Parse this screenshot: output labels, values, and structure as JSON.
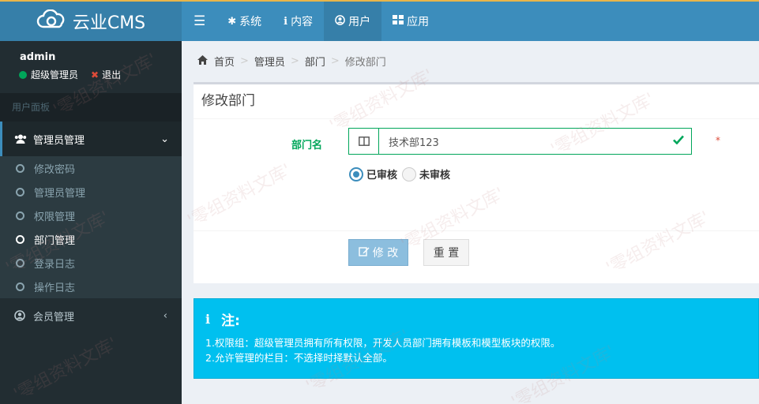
{
  "app": {
    "logo": "云业CMS"
  },
  "nav": [
    {
      "label": "系统",
      "icon": "gear-icon"
    },
    {
      "label": "内容",
      "icon": "info-icon"
    },
    {
      "label": "用户",
      "icon": "user-circle-icon",
      "active": true
    },
    {
      "label": "应用",
      "icon": "grid-icon"
    }
  ],
  "user": {
    "name": "admin",
    "role": "超级管理员",
    "logout": "退出"
  },
  "sidebar": {
    "header": "用户面板",
    "group": "管理员管理",
    "items": [
      {
        "label": "修改密码"
      },
      {
        "label": "管理员管理"
      },
      {
        "label": "权限管理"
      },
      {
        "label": "部门管理",
        "active": true
      },
      {
        "label": "登录日志"
      },
      {
        "label": "操作日志"
      }
    ],
    "member": "会员管理"
  },
  "breadcrumb": {
    "home": "首页",
    "b1": "管理员",
    "b2": "部门",
    "current": "修改部门"
  },
  "form": {
    "title": "修改部门",
    "dept_label": "部门名",
    "dept_value": "技术部123",
    "required_mark": "*",
    "radio_approved": "已审核",
    "radio_unapproved": "未审核",
    "submit": "修 改",
    "reset": "重 置"
  },
  "note": {
    "title": "注:",
    "line1": "1.权限组：超级管理员拥有所有权限，开发人员部门拥有模板和模型板块的权限。",
    "line2": "2.允许管理的栏目：不选择时择默认全部。"
  },
  "watermark": "'零组资料文库'",
  "colors": {
    "primary": "#3c8dbc",
    "sidebar": "#222d32",
    "success": "#00a65a",
    "info": "#00c0ef"
  }
}
